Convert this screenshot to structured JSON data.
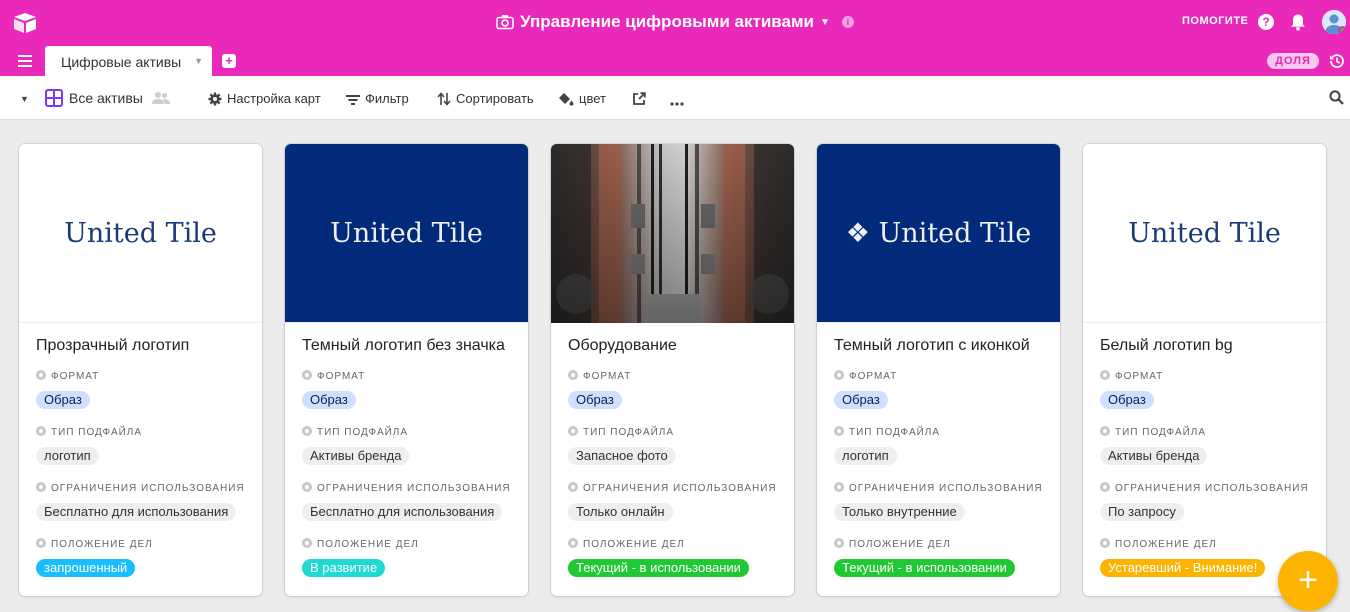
{
  "header": {
    "base_title": "Управление цифровыми активами",
    "help_label": "ПОМОГИТЕ",
    "help_icon_glyph": "?",
    "info_icon_glyph": "i"
  },
  "tabs": {
    "active_tab": "Цифровые активы",
    "share_label": "ДОЛЯ"
  },
  "toolbar": {
    "view_name": "Все активы",
    "customize": "Настройка карт",
    "filter": "Фильтр",
    "sort": "Сортировать",
    "color": "цвет"
  },
  "field_labels": {
    "format": "ФОРМАТ",
    "subtype": "ТИП ПОДФАЙЛА",
    "usage": "ОГРАНИЧЕНИЯ ИСПОЛЬЗОВАНИЯ",
    "status": "ПОЛОЖЕНИЕ ДЕЛ"
  },
  "cards": [
    {
      "cover_text": "United Tile",
      "cover_style": "light",
      "title": "Прозрачный логотип",
      "format": "Образ",
      "subtype": "логотип",
      "usage": "Бесплатно для использования",
      "status": "запрошенный",
      "status_color": "#18bfff"
    },
    {
      "cover_text": "United Tile",
      "cover_style": "dark",
      "title": "Темный логотип без значка",
      "format": "Образ",
      "subtype": "Активы бренда",
      "usage": "Бесплатно для использования",
      "status": "В развитие",
      "status_color": "#20d9d2"
    },
    {
      "cover_text": "",
      "cover_style": "photo",
      "title": "Оборудование",
      "format": "Образ",
      "subtype": "Запасное фото",
      "usage": "Только онлайн",
      "status": "Текущий - в использовании",
      "status_color": "#20c933"
    },
    {
      "cover_text": "❖ United Tile",
      "cover_style": "dark",
      "title": "Темный логотип с иконкой",
      "format": "Образ",
      "subtype": "логотип",
      "usage": "Только внутренние",
      "status": "Текущий - в использовании",
      "status_color": "#20c933"
    },
    {
      "cover_text": "United Tile",
      "cover_style": "light",
      "title": "Белый логотип bg",
      "format": "Образ",
      "subtype": "Активы бренда",
      "usage": "По запросу",
      "status": "Устаревший - Внимание!",
      "status_color": "#fcb400"
    }
  ],
  "fab": {
    "glyph": "+"
  },
  "colors": {
    "brand": "#e929ba",
    "format_pill": "#cfdfff",
    "dark_cover": "#012a7a"
  },
  "icons": [
    "app-logo-icon",
    "camera-icon",
    "help-icon",
    "bell-icon",
    "avatar",
    "hamburger-icon",
    "add-tab-icon",
    "history-icon",
    "gallery-view-icon",
    "people-icon",
    "gear-icon",
    "filter-icon",
    "sort-icon",
    "paint-bucket-icon",
    "share-out-icon",
    "more-icon",
    "search-icon",
    "plus-icon"
  ]
}
